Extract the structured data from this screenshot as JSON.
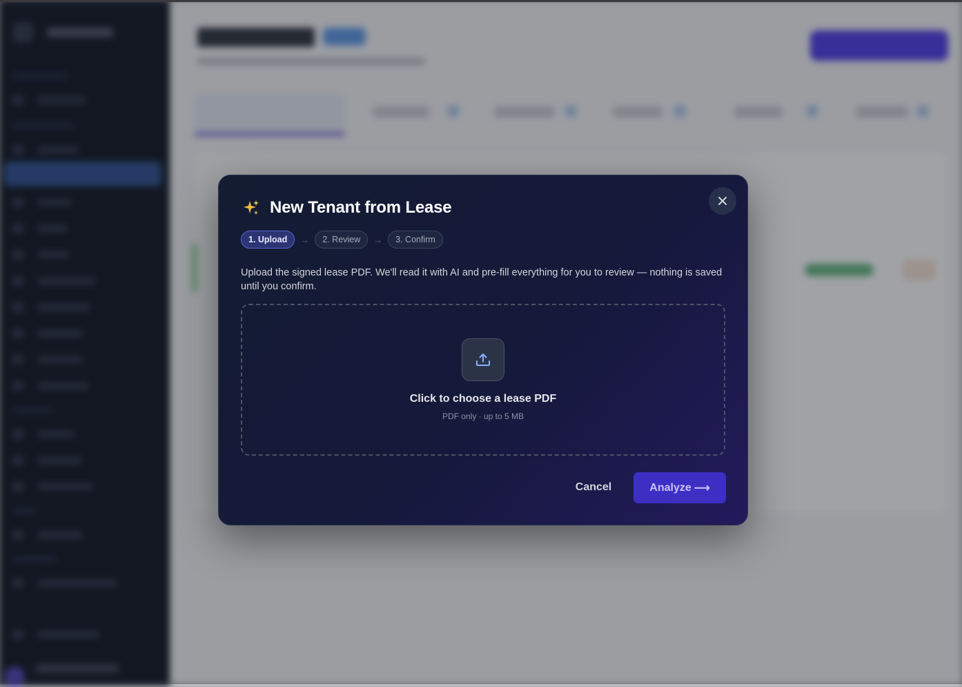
{
  "modal": {
    "title": "New Tenant from Lease",
    "steps": [
      {
        "label": "1. Upload",
        "active": true
      },
      {
        "label": "2. Review",
        "active": false
      },
      {
        "label": "3. Confirm",
        "active": false
      }
    ],
    "step_separator": "→",
    "description": "Upload the signed lease PDF. We'll read it with AI and pre-fill everything for you to review — nothing is saved until you confirm.",
    "dropzone": {
      "title": "Click to choose a lease PDF",
      "subtitle": "PDF only · up to 5 MB",
      "icon": "upload-icon"
    },
    "cancel_label": "Cancel",
    "analyze_label": "Analyze",
    "analyze_arrow": "⟶",
    "close_icon": "close-icon",
    "title_icon": "sparkles-icon"
  },
  "colors": {
    "accent": "#3d2fc4",
    "modal_bg": "#141c32",
    "sparkle": "#f5b942"
  }
}
